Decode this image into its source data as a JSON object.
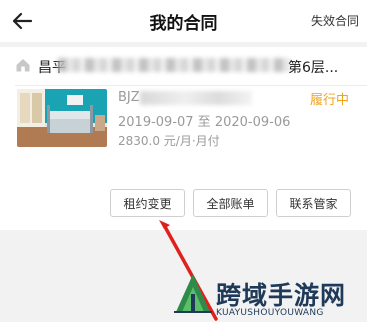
{
  "header": {
    "title": "我的合同",
    "expired_contracts_label": "失效合同",
    "back_icon": "back-arrow-icon"
  },
  "contract": {
    "address_start": "昌平",
    "address_end": "第6层...",
    "contract_no_prefix": "BJZ",
    "status": "履行中",
    "status_color": "#f0a31a",
    "dates": "2019-09-07 至 2020-09-06",
    "rent": "2830.0 元/月·月付",
    "home_icon": "home-icon"
  },
  "actions": {
    "lease_change": "租约变更",
    "all_bills": "全部账单",
    "contact_steward": "联系管家"
  },
  "watermark": {
    "name": "跨域手游网",
    "domain": "KUAYUSHOUYOUWANG"
  },
  "colors": {
    "annotation_arrow": "#e0201c",
    "status": "#f0a31a",
    "watermark": "#1f3a58"
  }
}
